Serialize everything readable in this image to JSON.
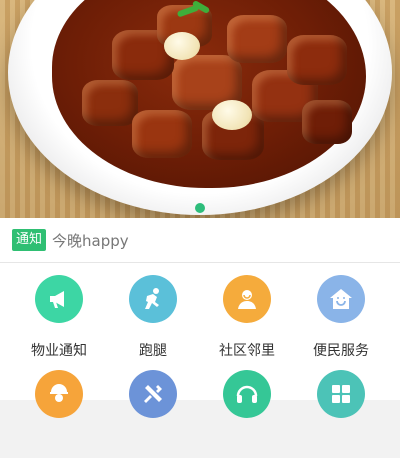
{
  "banner": {
    "image_desc": "braised pork belly in white bowl",
    "active_dot_color": "#2ebd7b"
  },
  "notice": {
    "badge": "通知",
    "text": "今晚happy"
  },
  "grid": {
    "items": [
      {
        "label": "物业通知",
        "icon": "megaphone-icon",
        "color": "#3dd6a4"
      },
      {
        "label": "跑腿",
        "icon": "runner-icon",
        "color": "#5bc0d9"
      },
      {
        "label": "社区邻里",
        "icon": "neighbors-icon",
        "color": "#f5ab3c"
      },
      {
        "label": "便民服务",
        "icon": "home-smile-icon",
        "color": "#8ab4e8"
      },
      {
        "label": "",
        "icon": "worker-icon",
        "color": "#f6a43a"
      },
      {
        "label": "",
        "icon": "tools-icon",
        "color": "#6c93d8"
      },
      {
        "label": "",
        "icon": "headset-icon",
        "color": "#35c796"
      },
      {
        "label": "",
        "icon": "apps-grid-icon",
        "color": "#4cc3b7"
      }
    ]
  }
}
